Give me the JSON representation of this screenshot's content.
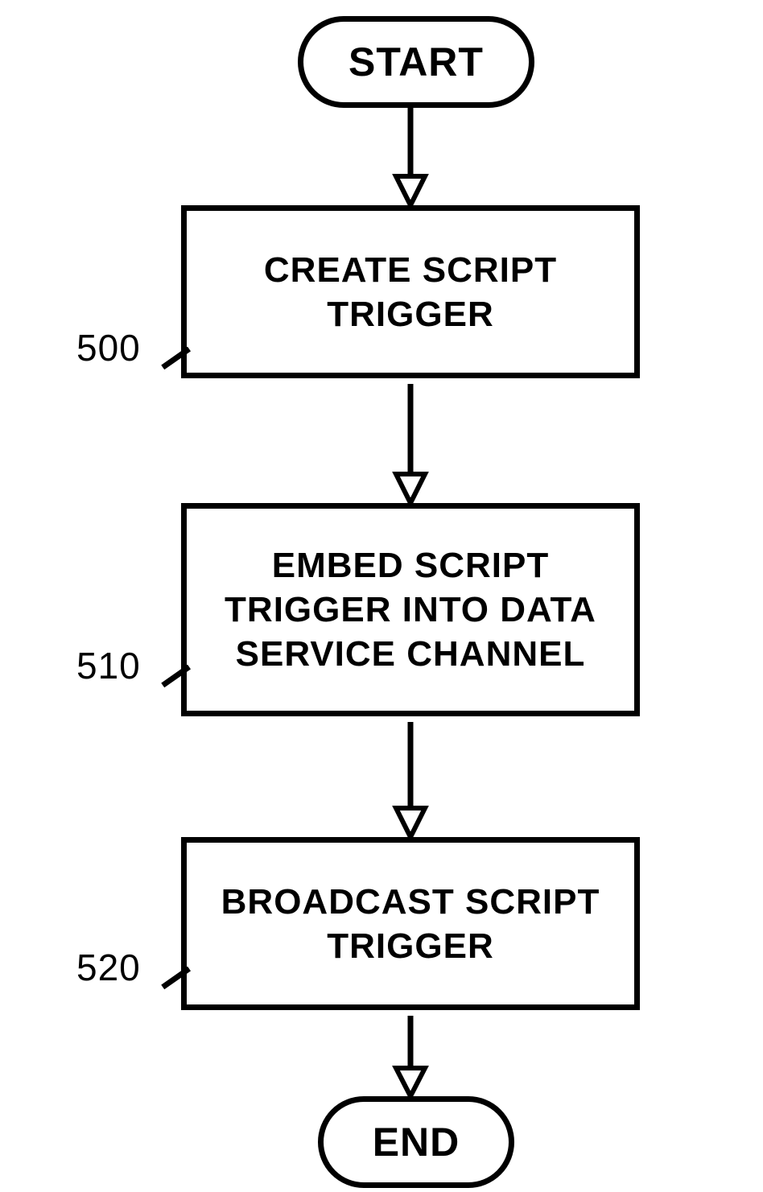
{
  "terminator_start": "START",
  "terminator_end": "END",
  "step1": {
    "ref": "500",
    "text": "CREATE SCRIPT TRIGGER"
  },
  "step2": {
    "ref": "510",
    "text": "EMBED SCRIPT TRIGGER INTO DATA SERVICE CHANNEL"
  },
  "step3": {
    "ref": "520",
    "text": "BROADCAST SCRIPT TRIGGER"
  }
}
